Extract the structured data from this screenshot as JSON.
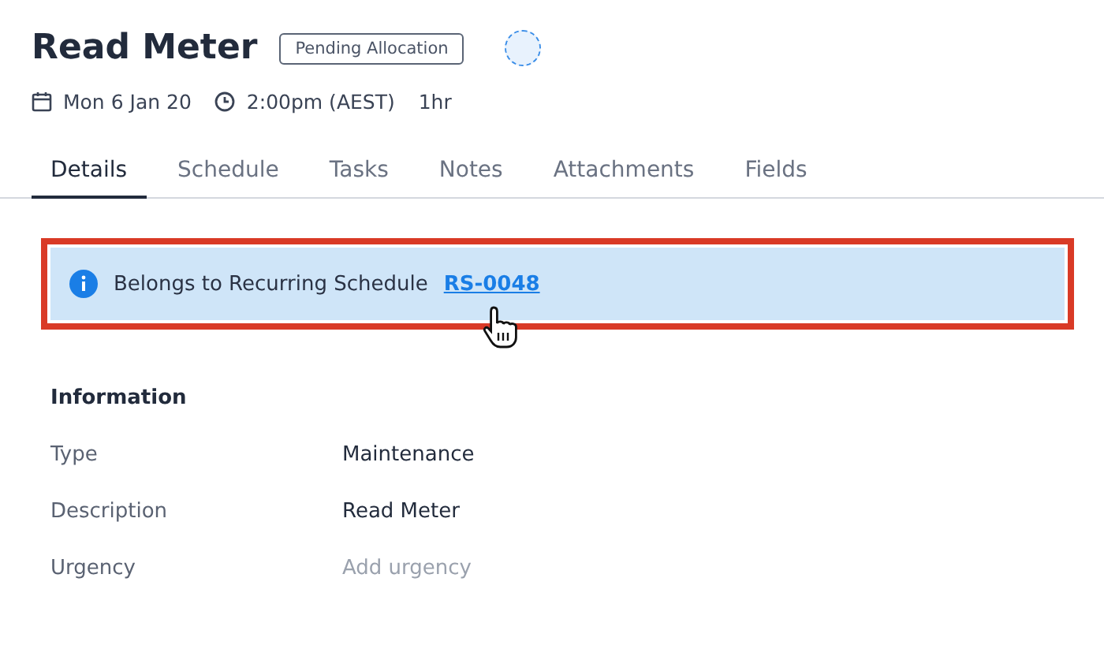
{
  "header": {
    "title": "Read Meter",
    "status_badge": "Pending Allocation",
    "date": "Mon 6 Jan 20",
    "time": "2:00pm (AEST)",
    "duration": "1hr"
  },
  "tabs": [
    {
      "label": "Details",
      "selected": true
    },
    {
      "label": "Schedule",
      "selected": false
    },
    {
      "label": "Tasks",
      "selected": false
    },
    {
      "label": "Notes",
      "selected": false
    },
    {
      "label": "Attachments",
      "selected": false
    },
    {
      "label": "Fields",
      "selected": false
    }
  ],
  "banner": {
    "text": "Belongs to Recurring Schedule",
    "link": "RS-0048"
  },
  "information": {
    "heading": "Information",
    "rows": [
      {
        "label": "Type",
        "value": "Maintenance",
        "kind": "value"
      },
      {
        "label": "Description",
        "value": "Read Meter",
        "kind": "value"
      },
      {
        "label": "Urgency",
        "value": "Add urgency",
        "kind": "placeholder"
      }
    ]
  }
}
